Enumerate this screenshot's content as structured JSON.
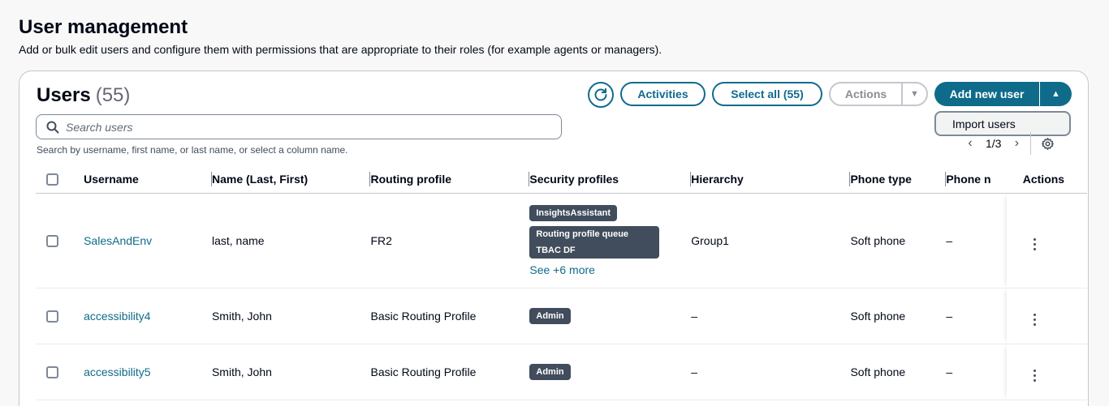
{
  "page": {
    "title": "User management",
    "description": "Add or bulk edit users and configure them with permissions that are appropriate to their roles (for example agents or managers)."
  },
  "panel": {
    "title": "Users",
    "count": "(55)",
    "buttons": {
      "activities": "Activities",
      "select_all": "Select all (55)",
      "actions": "Actions",
      "add_new_user": "Add new user"
    },
    "dropdown_items": [
      "Import users"
    ],
    "search": {
      "placeholder": "Search users",
      "hint": "Search by username, first name, or last name, or select a column name."
    },
    "pagination": {
      "current": "1/3"
    }
  },
  "table": {
    "columns": [
      "Username",
      "Name (Last, First)",
      "Routing profile",
      "Security profiles",
      "Hierarchy",
      "Phone type",
      "Phone n",
      "Actions"
    ],
    "rows": [
      {
        "username": "SalesAndEnv",
        "name": "last, name",
        "routing_profile": "FR2",
        "security_profiles": [
          "InsightsAssistant",
          "Routing profile queue TBAC DF"
        ],
        "see_more": "See +6 more",
        "hierarchy": "Group1",
        "phone_type": "Soft phone",
        "phone_number": "–"
      },
      {
        "username": "accessibility4",
        "name": "Smith, John",
        "routing_profile": "Basic Routing Profile",
        "security_profiles": [
          "Admin"
        ],
        "hierarchy": "–",
        "phone_type": "Soft phone",
        "phone_number": "–"
      },
      {
        "username": "accessibility5",
        "name": "Smith, John",
        "routing_profile": "Basic Routing Profile",
        "security_profiles": [
          "Admin"
        ],
        "hierarchy": "–",
        "phone_type": "Soft phone",
        "phone_number": "–"
      }
    ]
  },
  "colors": {
    "primary": "#0f6b8a",
    "badge": "#414d5c",
    "border": "#c6c6cd"
  }
}
